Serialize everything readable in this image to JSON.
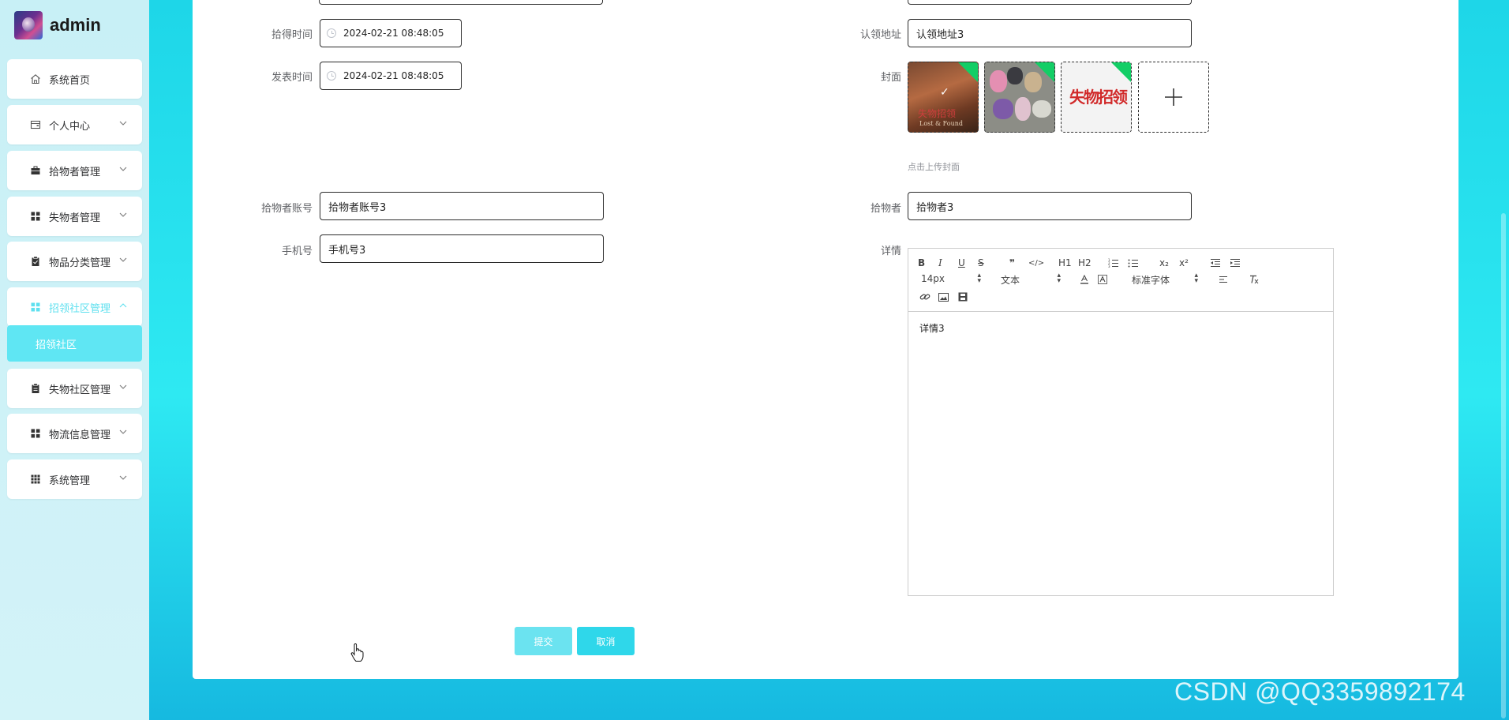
{
  "brand": {
    "name": "admin"
  },
  "sidebar": {
    "items": [
      {
        "label": "系统首页",
        "icon": "home-icon"
      },
      {
        "label": "个人中心",
        "icon": "wallet-icon"
      },
      {
        "label": "拾物者管理",
        "icon": "briefcase-icon"
      },
      {
        "label": "失物者管理",
        "icon": "grid-icon"
      },
      {
        "label": "物品分类管理",
        "icon": "clipboard-icon"
      },
      {
        "label": "招领社区管理",
        "icon": "grid-icon"
      },
      {
        "label": "失物社区管理",
        "icon": "clipboard-icon"
      },
      {
        "label": "物流信息管理",
        "icon": "grid-icon"
      },
      {
        "label": "系统管理",
        "icon": "apps-icon"
      }
    ],
    "submenu": {
      "label": "招领社区"
    }
  },
  "form": {
    "pickup_time": {
      "label": "拾得时间",
      "value": "2024-02-21 08:48:05"
    },
    "publish_time": {
      "label": "发表时间",
      "value": "2024-02-21 08:48:05"
    },
    "claim_address": {
      "label": "认领地址",
      "value": "认领地址3"
    },
    "cover": {
      "label": "封面",
      "tip": "点击上传封面",
      "thumb1_text1": "失物招领",
      "thumb1_text2": "Lost & Found",
      "thumb3_text": "失物招领"
    },
    "finder_account": {
      "label": "拾物者账号",
      "value": "拾物者账号3"
    },
    "finder": {
      "label": "拾物者",
      "value": "拾物者3"
    },
    "phone": {
      "label": "手机号",
      "value": "手机号3"
    },
    "details": {
      "label": "详情",
      "content": "详情3",
      "toolbar": {
        "bold": "B",
        "italic": "I",
        "underline": "U",
        "strike": "S",
        "quote": "❞",
        "code": "</>",
        "h1": "H1",
        "h2": "H2",
        "sub": "x₂",
        "sup": "x²",
        "size": "14px",
        "header": "文本",
        "font": "标准字体"
      }
    }
  },
  "buttons": {
    "submit": "提交",
    "cancel": "取消"
  },
  "watermark": "CSDN @QQ3359892174",
  "colors": {
    "accent": "#2fd7ea",
    "accent_light": "#6be3f0",
    "success_flag": "#13ce66"
  }
}
